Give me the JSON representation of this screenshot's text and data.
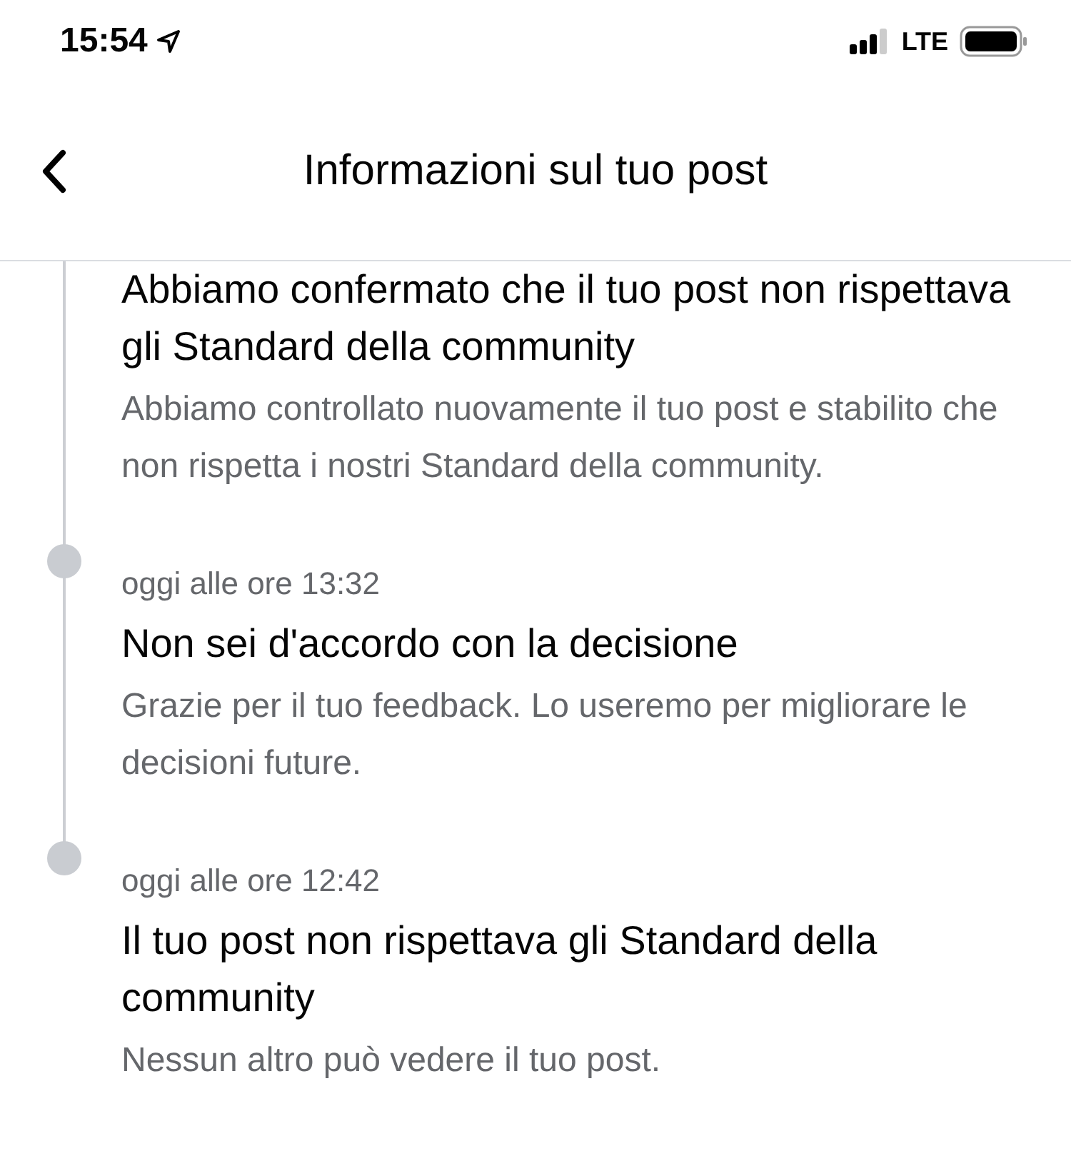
{
  "status_bar": {
    "time": "15:54",
    "network": "LTE"
  },
  "header": {
    "title": "Informazioni sul tuo post"
  },
  "timeline": [
    {
      "title": "Abbiamo confermato che il tuo post non rispettava gli Standard della community",
      "description": "Abbiamo controllato nuovamente il tuo post e stabilito che non rispetta i nostri Standard della community."
    },
    {
      "time": "oggi alle ore 13:32",
      "title": "Non sei d'accordo con la decisione",
      "description": "Grazie per il tuo feedback. Lo useremo per migliorare le decisioni future."
    },
    {
      "time": "oggi alle ore 12:42",
      "title": "Il tuo post non rispettava gli Standard della community",
      "description": "Nessun altro può vedere il tuo post."
    }
  ]
}
